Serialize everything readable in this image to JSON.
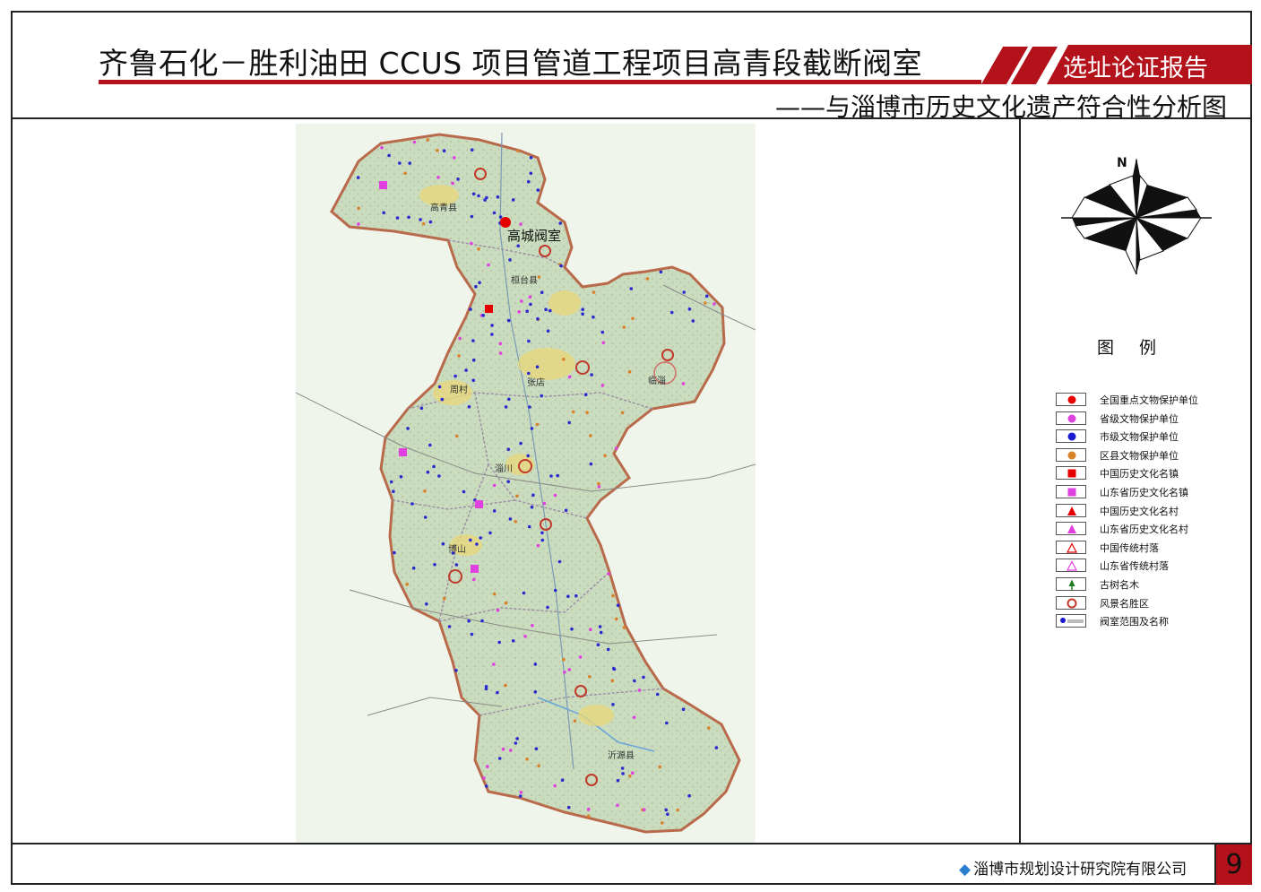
{
  "header": {
    "title": "齐鲁石化－胜利油田 CCUS 项目管道工程项目高青段截断阀室",
    "banner": "选址论证报告",
    "subtitle": "——与淄博市历史文化遗产符合性分析图"
  },
  "map": {
    "site_label": "高城阀室",
    "district_labels": [
      "高青县",
      "桓台县",
      "临淄",
      "张店",
      "周村",
      "淄川",
      "博山",
      "沂源县"
    ],
    "colors": {
      "land": "#cfe0c4",
      "boundary": "#b86a4a",
      "site_marker": "#e60000",
      "city_marker": "#2a2ad0",
      "scenic_ring": "#c0392b",
      "town_marker": "#e040e0"
    }
  },
  "compass": {
    "north_label": "N"
  },
  "legend": {
    "title": "图例",
    "items": [
      {
        "label": "全国重点文物保护单位",
        "symbol": "circle",
        "color": "#e60000"
      },
      {
        "label": "省级文物保护单位",
        "symbol": "circle",
        "color": "#e040e0"
      },
      {
        "label": "市级文物保护单位",
        "symbol": "circle",
        "color": "#1a1ad0"
      },
      {
        "label": "区县文物保护单位",
        "symbol": "circle",
        "color": "#d9822b"
      },
      {
        "label": "中国历史文化名镇",
        "symbol": "square",
        "color": "#e60000"
      },
      {
        "label": "山东省历史文化名镇",
        "symbol": "square",
        "color": "#e040e0"
      },
      {
        "label": "中国历史文化名村",
        "symbol": "triangle",
        "color": "#e60000"
      },
      {
        "label": "山东省历史文化名村",
        "symbol": "triangle",
        "color": "#e040e0"
      },
      {
        "label": "中国传统村落",
        "symbol": "triangle-outline",
        "color": "#e60000"
      },
      {
        "label": "山东省传统村落",
        "symbol": "triangle-outline",
        "color": "#e040e0"
      },
      {
        "label": "古树名木",
        "symbol": "tree",
        "color": "#1e7a1e"
      },
      {
        "label": "风景名胜区",
        "symbol": "ring",
        "color": "#c0392b"
      },
      {
        "label": "阀室范围及名称",
        "symbol": "site",
        "color": "#1a1ad0"
      }
    ]
  },
  "footer": {
    "company": "淄博市规划设计研究院有限公司",
    "page_number": "9"
  }
}
